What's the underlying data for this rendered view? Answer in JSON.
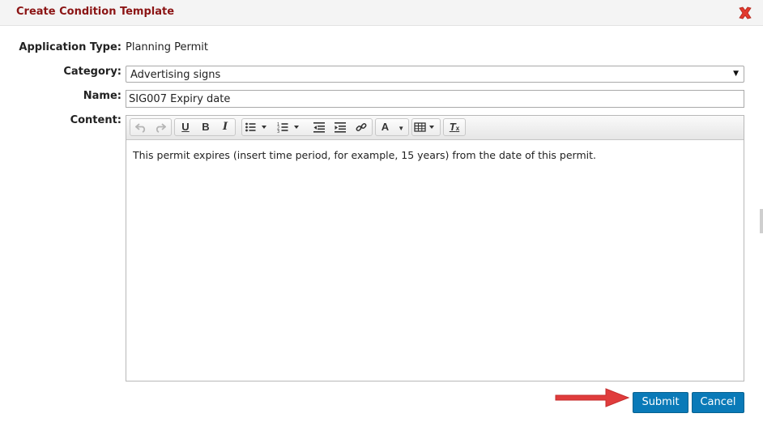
{
  "dialog": {
    "title": "Create Condition Template",
    "close_icon": "close-icon"
  },
  "form": {
    "application_type_label": "Application Type:",
    "application_type_value": "Planning Permit",
    "category_label": "Category:",
    "category_value": "Advertising signs",
    "name_label": "Name:",
    "name_value": "SIG007 Expiry date",
    "content_label": "Content:"
  },
  "toolbar": {
    "buttons": [
      {
        "icon": "undo-icon"
      },
      {
        "icon": "redo-icon"
      },
      {
        "icon": "underline-icon",
        "glyph": "U"
      },
      {
        "icon": "bold-icon",
        "glyph": "B"
      },
      {
        "icon": "italic-icon",
        "glyph": "I"
      },
      {
        "icon": "bullet-list-icon"
      },
      {
        "icon": "numbered-list-icon"
      },
      {
        "icon": "outdent-icon"
      },
      {
        "icon": "indent-icon"
      },
      {
        "icon": "link-icon"
      },
      {
        "icon": "font-color-icon",
        "glyph": "A"
      },
      {
        "icon": "table-icon"
      },
      {
        "icon": "clear-format-icon",
        "glyph": "T",
        "subglyph": "x"
      }
    ]
  },
  "editor": {
    "content": "This permit expires (insert time period, for example, 15 years) from the date of this permit."
  },
  "actions": {
    "submit_label": "Submit",
    "cancel_label": "Cancel"
  },
  "colors": {
    "title": "#8b1414",
    "button": "#0a7ab8",
    "annotation_arrow": "#e03c3c"
  }
}
